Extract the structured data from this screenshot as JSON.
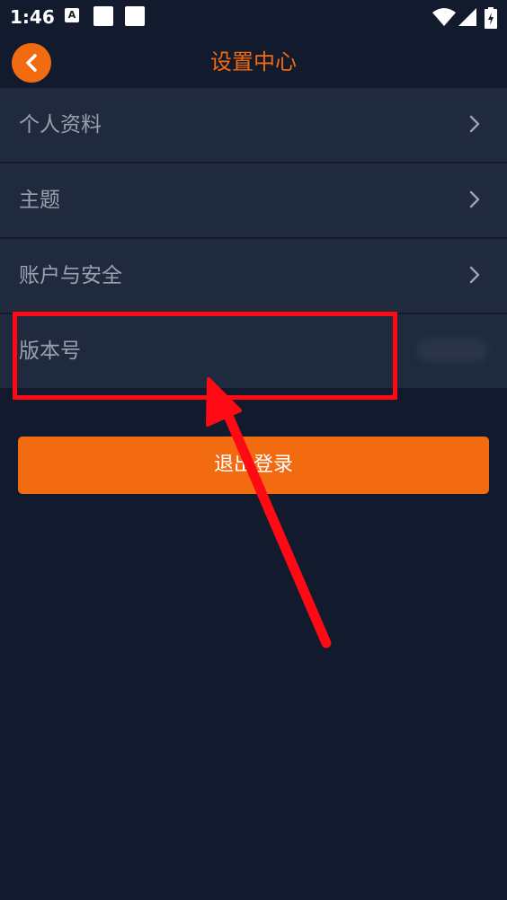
{
  "status_bar": {
    "time": "1:46",
    "icons": [
      "a-icon",
      "notification-square-icon",
      "notification-square-icon",
      "wifi-icon",
      "signal-icon",
      "battery-icon"
    ]
  },
  "header": {
    "title": "设置中心",
    "back_icon": "chevron-left-icon"
  },
  "menu": {
    "items": [
      {
        "label": "个人资料",
        "icon": "chevron-right-icon"
      },
      {
        "label": "主题",
        "icon": "chevron-right-icon"
      },
      {
        "label": "账户与安全",
        "icon": "chevron-right-icon"
      },
      {
        "label": "版本号",
        "value_blurred": true
      }
    ]
  },
  "logout": {
    "label": "退出登录"
  },
  "colors": {
    "background": "#121a2d",
    "row": "#1f2a3e",
    "accent": "#f36b10",
    "annotation": "#ff0a14"
  }
}
